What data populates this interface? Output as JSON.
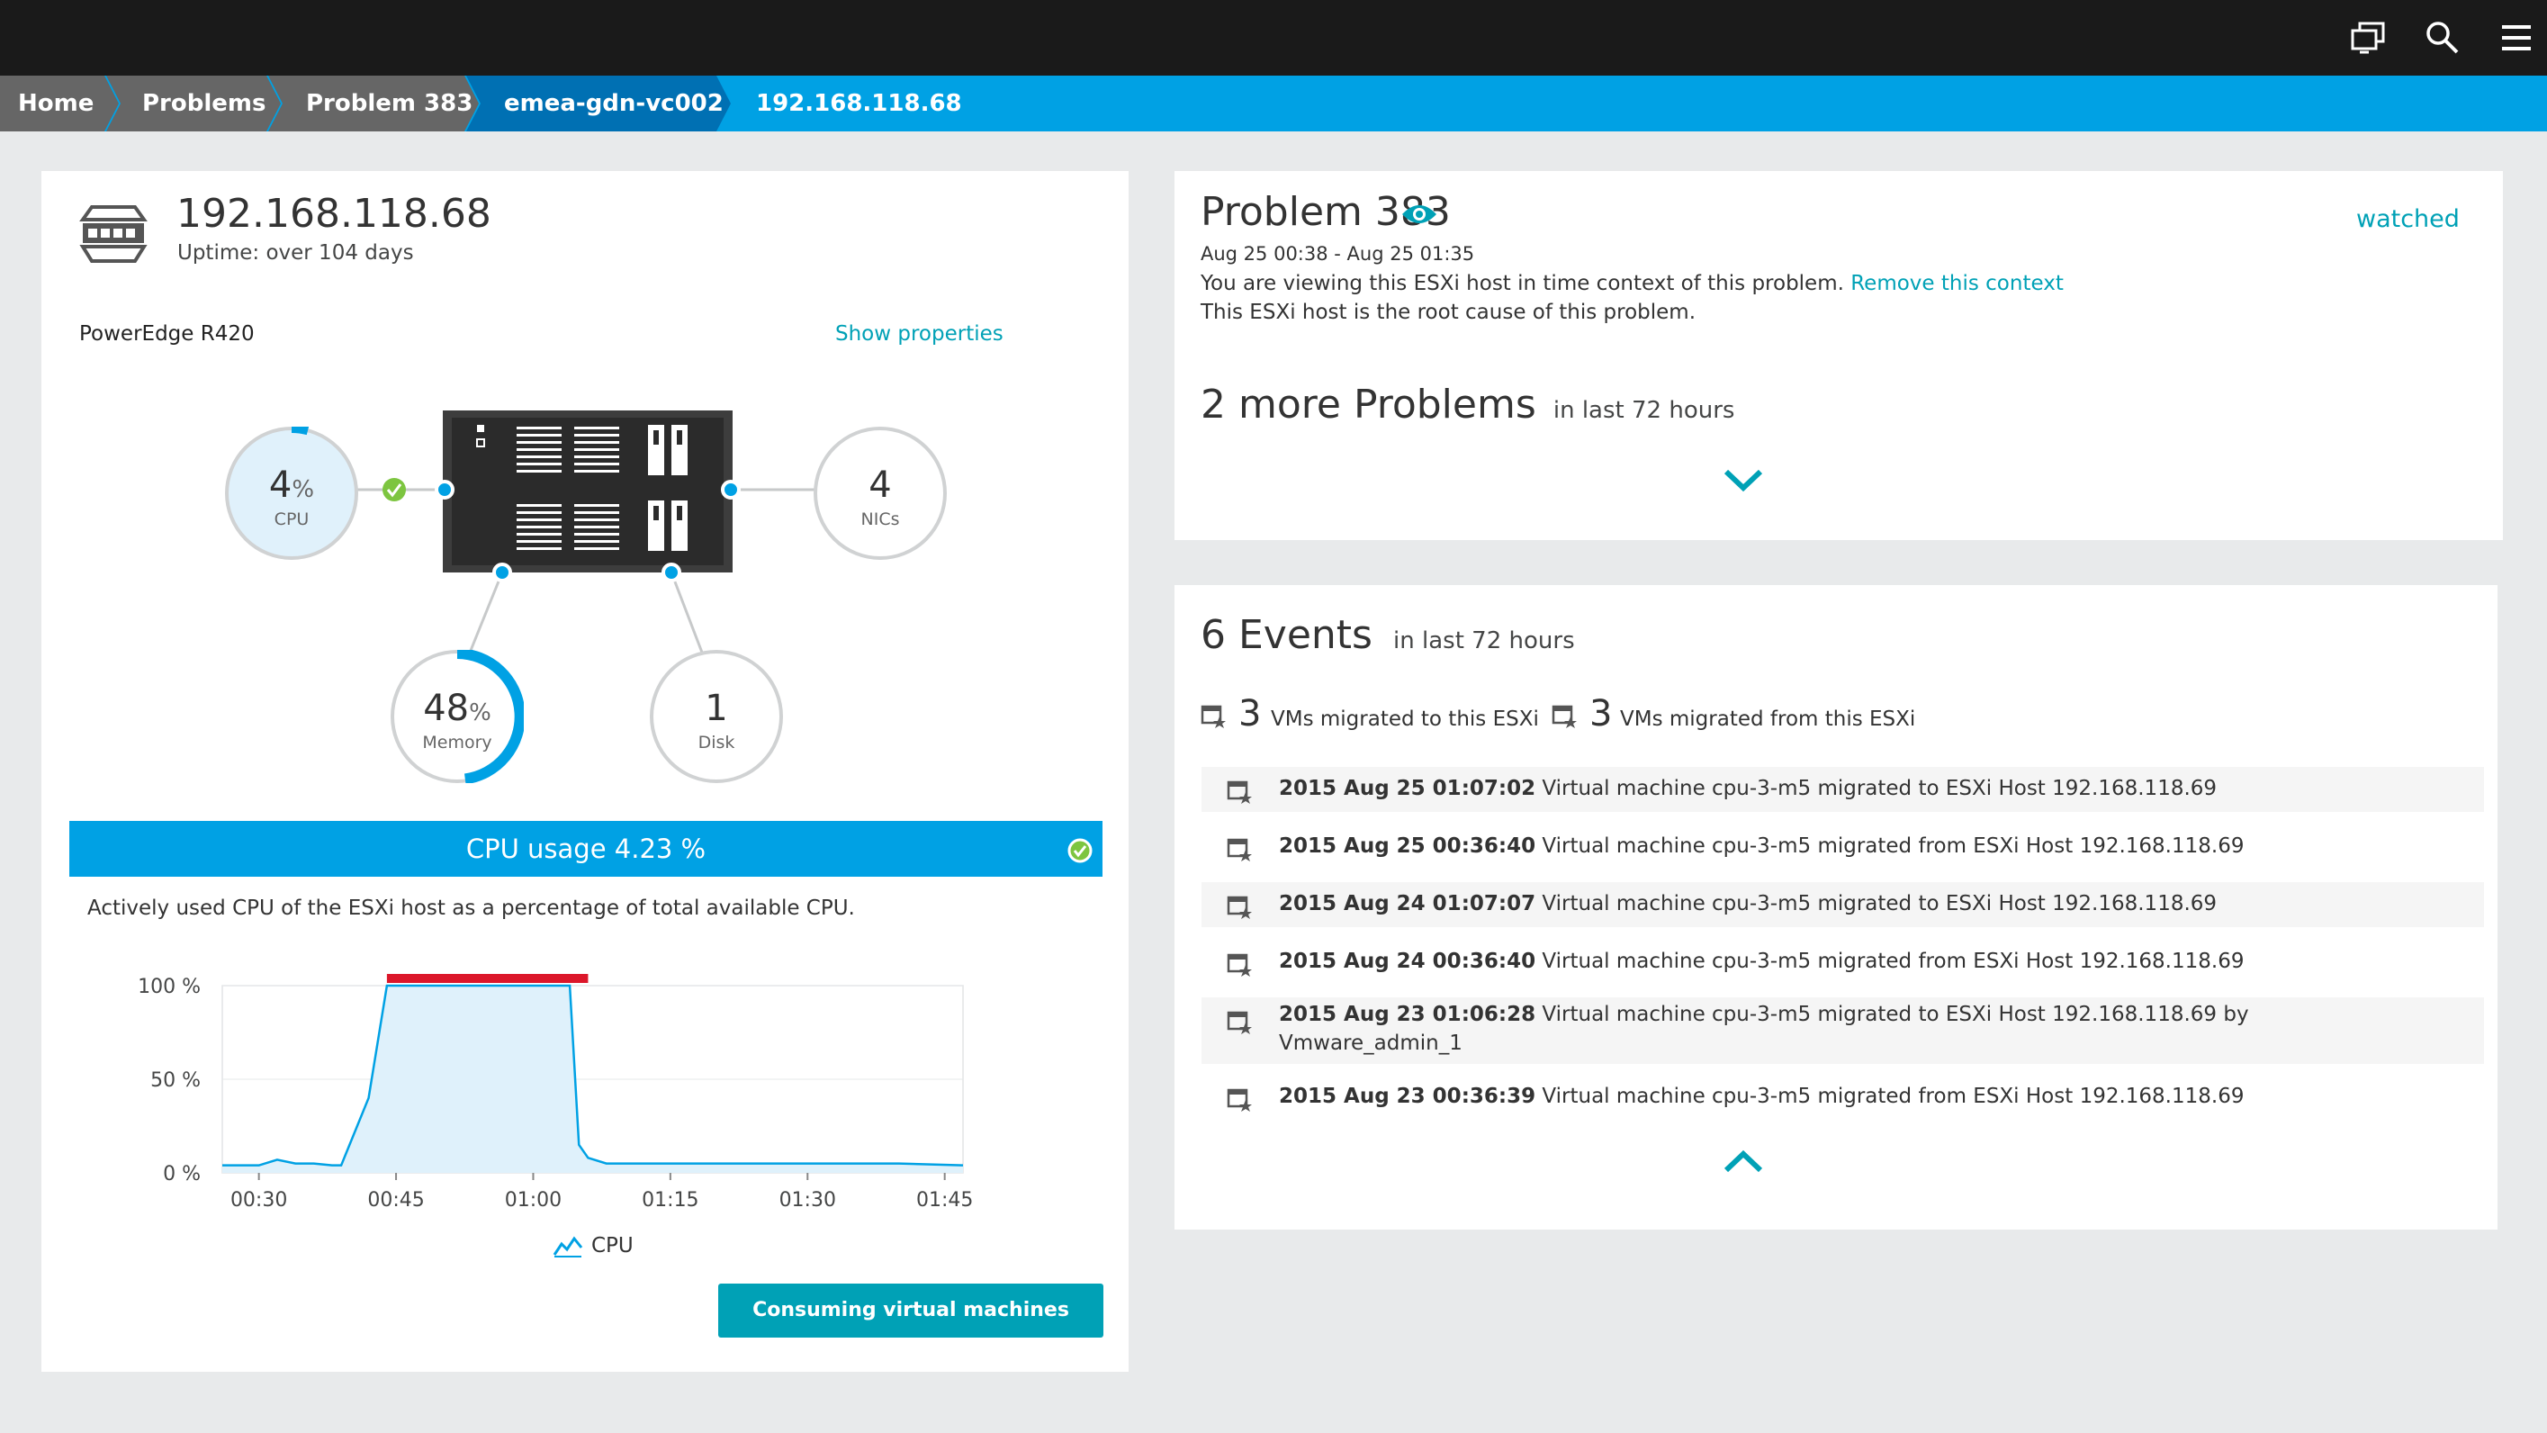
{
  "header": {
    "icons": [
      "screen-icon",
      "search-icon",
      "menu-icon"
    ]
  },
  "breadcrumb": {
    "items": [
      "Home",
      "Problems",
      "Problem 383",
      "emea-gdn-vc002",
      "192.168.118.68"
    ]
  },
  "host": {
    "title": "192.168.118.68",
    "uptime": "Uptime: over 104 days",
    "model": "PowerEdge R420",
    "show_properties": "Show properties",
    "cpu": {
      "value": "4",
      "unit": "%",
      "label": "CPU"
    },
    "nics": {
      "value": "4",
      "label": "NICs"
    },
    "memory": {
      "value": "48",
      "unit": "%",
      "label": "Memory"
    },
    "disk": {
      "value": "1",
      "label": "Disk"
    }
  },
  "cpu_usage": {
    "title": "CPU usage 4.23 %",
    "description": "Actively used CPU of the ESXi host as a percentage of total available CPU.",
    "legend": "CPU",
    "button": "Consuming virtual machines"
  },
  "chart_data": {
    "type": "area",
    "x": [
      "00:26",
      "00:30",
      "00:32",
      "00:34",
      "00:36",
      "00:38",
      "00:39",
      "00:42",
      "00:44",
      "00:50",
      "00:55",
      "01:00",
      "01:04",
      "01:05",
      "01:06",
      "01:08",
      "01:15",
      "01:20",
      "01:30",
      "01:40",
      "01:47"
    ],
    "x_ticks": [
      "00:30",
      "00:45",
      "01:00",
      "01:15",
      "01:30",
      "01:45"
    ],
    "y_ticks": [
      "100 %",
      "50 %",
      "0 %"
    ],
    "series": [
      {
        "name": "CPU",
        "values": [
          4,
          4,
          7,
          5,
          5,
          4,
          4,
          40,
          100,
          100,
          100,
          100,
          100,
          15,
          8,
          5,
          5,
          5,
          5,
          5,
          4
        ]
      }
    ],
    "ylim": [
      0,
      100
    ],
    "problem_range": [
      "00:44",
      "01:06"
    ],
    "colors": {
      "line": "#00a1e4",
      "fill": "#dff1fb",
      "problem": "#dc172a"
    }
  },
  "problem": {
    "title": "Problem 383",
    "watched": "watched",
    "time_range": "Aug 25 00:38 - Aug 25 01:35",
    "context_text": "You are viewing this ESXi host in time context of this problem.",
    "remove_context": "Remove this context",
    "root_cause": "This ESXi host is the root cause of this problem.",
    "more_count_text": "2 more Problems",
    "more_period": "in last 72 hours"
  },
  "events": {
    "title": "6 Events",
    "period": "in last 72 hours",
    "migrated_to_count": "3",
    "migrated_to_label": "VMs migrated to this ESXi",
    "migrated_from_count": "3",
    "migrated_from_label": "VMs migrated from this ESXi",
    "items": [
      {
        "time": "2015 Aug 25 01:07:02",
        "text": " Virtual machine cpu-3-m5 migrated to ESXi Host 192.168.118.69",
        "text2": ""
      },
      {
        "time": "2015 Aug 25 00:36:40",
        "text": " Virtual machine cpu-3-m5 migrated from ESXi Host 192.168.118.69",
        "text2": ""
      },
      {
        "time": "2015 Aug 24 01:07:07",
        "text": " Virtual machine cpu-3-m5 migrated to ESXi Host 192.168.118.69",
        "text2": ""
      },
      {
        "time": "2015 Aug 24 00:36:40",
        "text": " Virtual machine cpu-3-m5 migrated from ESXi Host 192.168.118.69",
        "text2": ""
      },
      {
        "time": "2015 Aug 23 01:06:28",
        "text": " Virtual machine cpu-3-m5 migrated to ESXi Host 192.168.118.69 by",
        "text2": "Vmware_admin_1"
      },
      {
        "time": "2015 Aug 23 00:36:39",
        "text": " Virtual machine cpu-3-m5 migrated from ESXi Host 192.168.118.69",
        "text2": ""
      }
    ]
  },
  "colors": {
    "accent": "#00a1e4",
    "link": "#00a1b6",
    "ok": "#7dc540",
    "problem": "#dc172a",
    "topbar": "#1a1a1a"
  }
}
